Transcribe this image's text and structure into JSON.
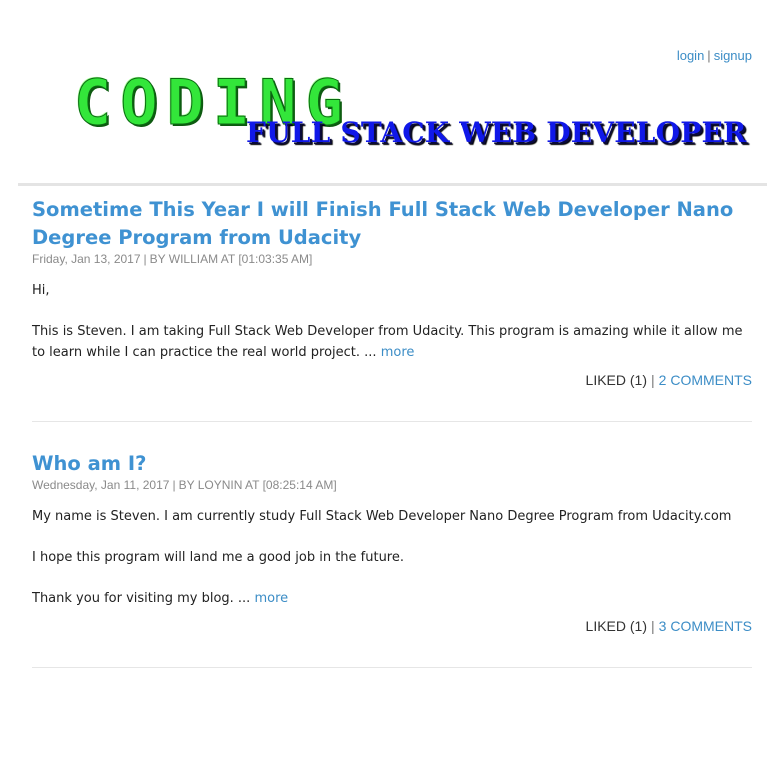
{
  "header": {
    "login_label": "login",
    "separator": "|",
    "signup_label": "signup",
    "logo_title": "CODING",
    "logo_subtitle": "FULL STACK WEB DEVELOPER",
    "logo_colors": {
      "title": "#33e63a",
      "subtitle": "#1018e8"
    }
  },
  "accent_color": "#3c8dc6",
  "posts": [
    {
      "title": "Sometime This Year I will Finish Full Stack Web Developer Nano Degree Program from Udacity",
      "date": "Friday, Jan 13, 2017",
      "meta_sep": "|",
      "byline": "BY WILLIAM AT [01:03:35 AM]",
      "paragraphs": [
        "Hi,",
        "This is Steven. I am taking Full Stack Web Developer from Udacity. This program is amazing while it allow me to learn while I can practice the real world project. ..."
      ],
      "more_label": "more",
      "liked_label": "LIKED (1)",
      "footer_sep": "|",
      "comments_label": "2 COMMENTS"
    },
    {
      "title": "Who am I?",
      "date": "Wednesday, Jan 11, 2017",
      "meta_sep": "|",
      "byline": "BY LOYNIN AT [08:25:14 AM]",
      "paragraphs": [
        "My name is Steven. I am currently study Full Stack Web Developer Nano Degree Program from Udacity.com",
        "I hope this program will land me a good job in the future.",
        "Thank you for visiting my blog. ..."
      ],
      "more_label": "more",
      "liked_label": "LIKED (1)",
      "footer_sep": "|",
      "comments_label": "3 COMMENTS"
    }
  ]
}
